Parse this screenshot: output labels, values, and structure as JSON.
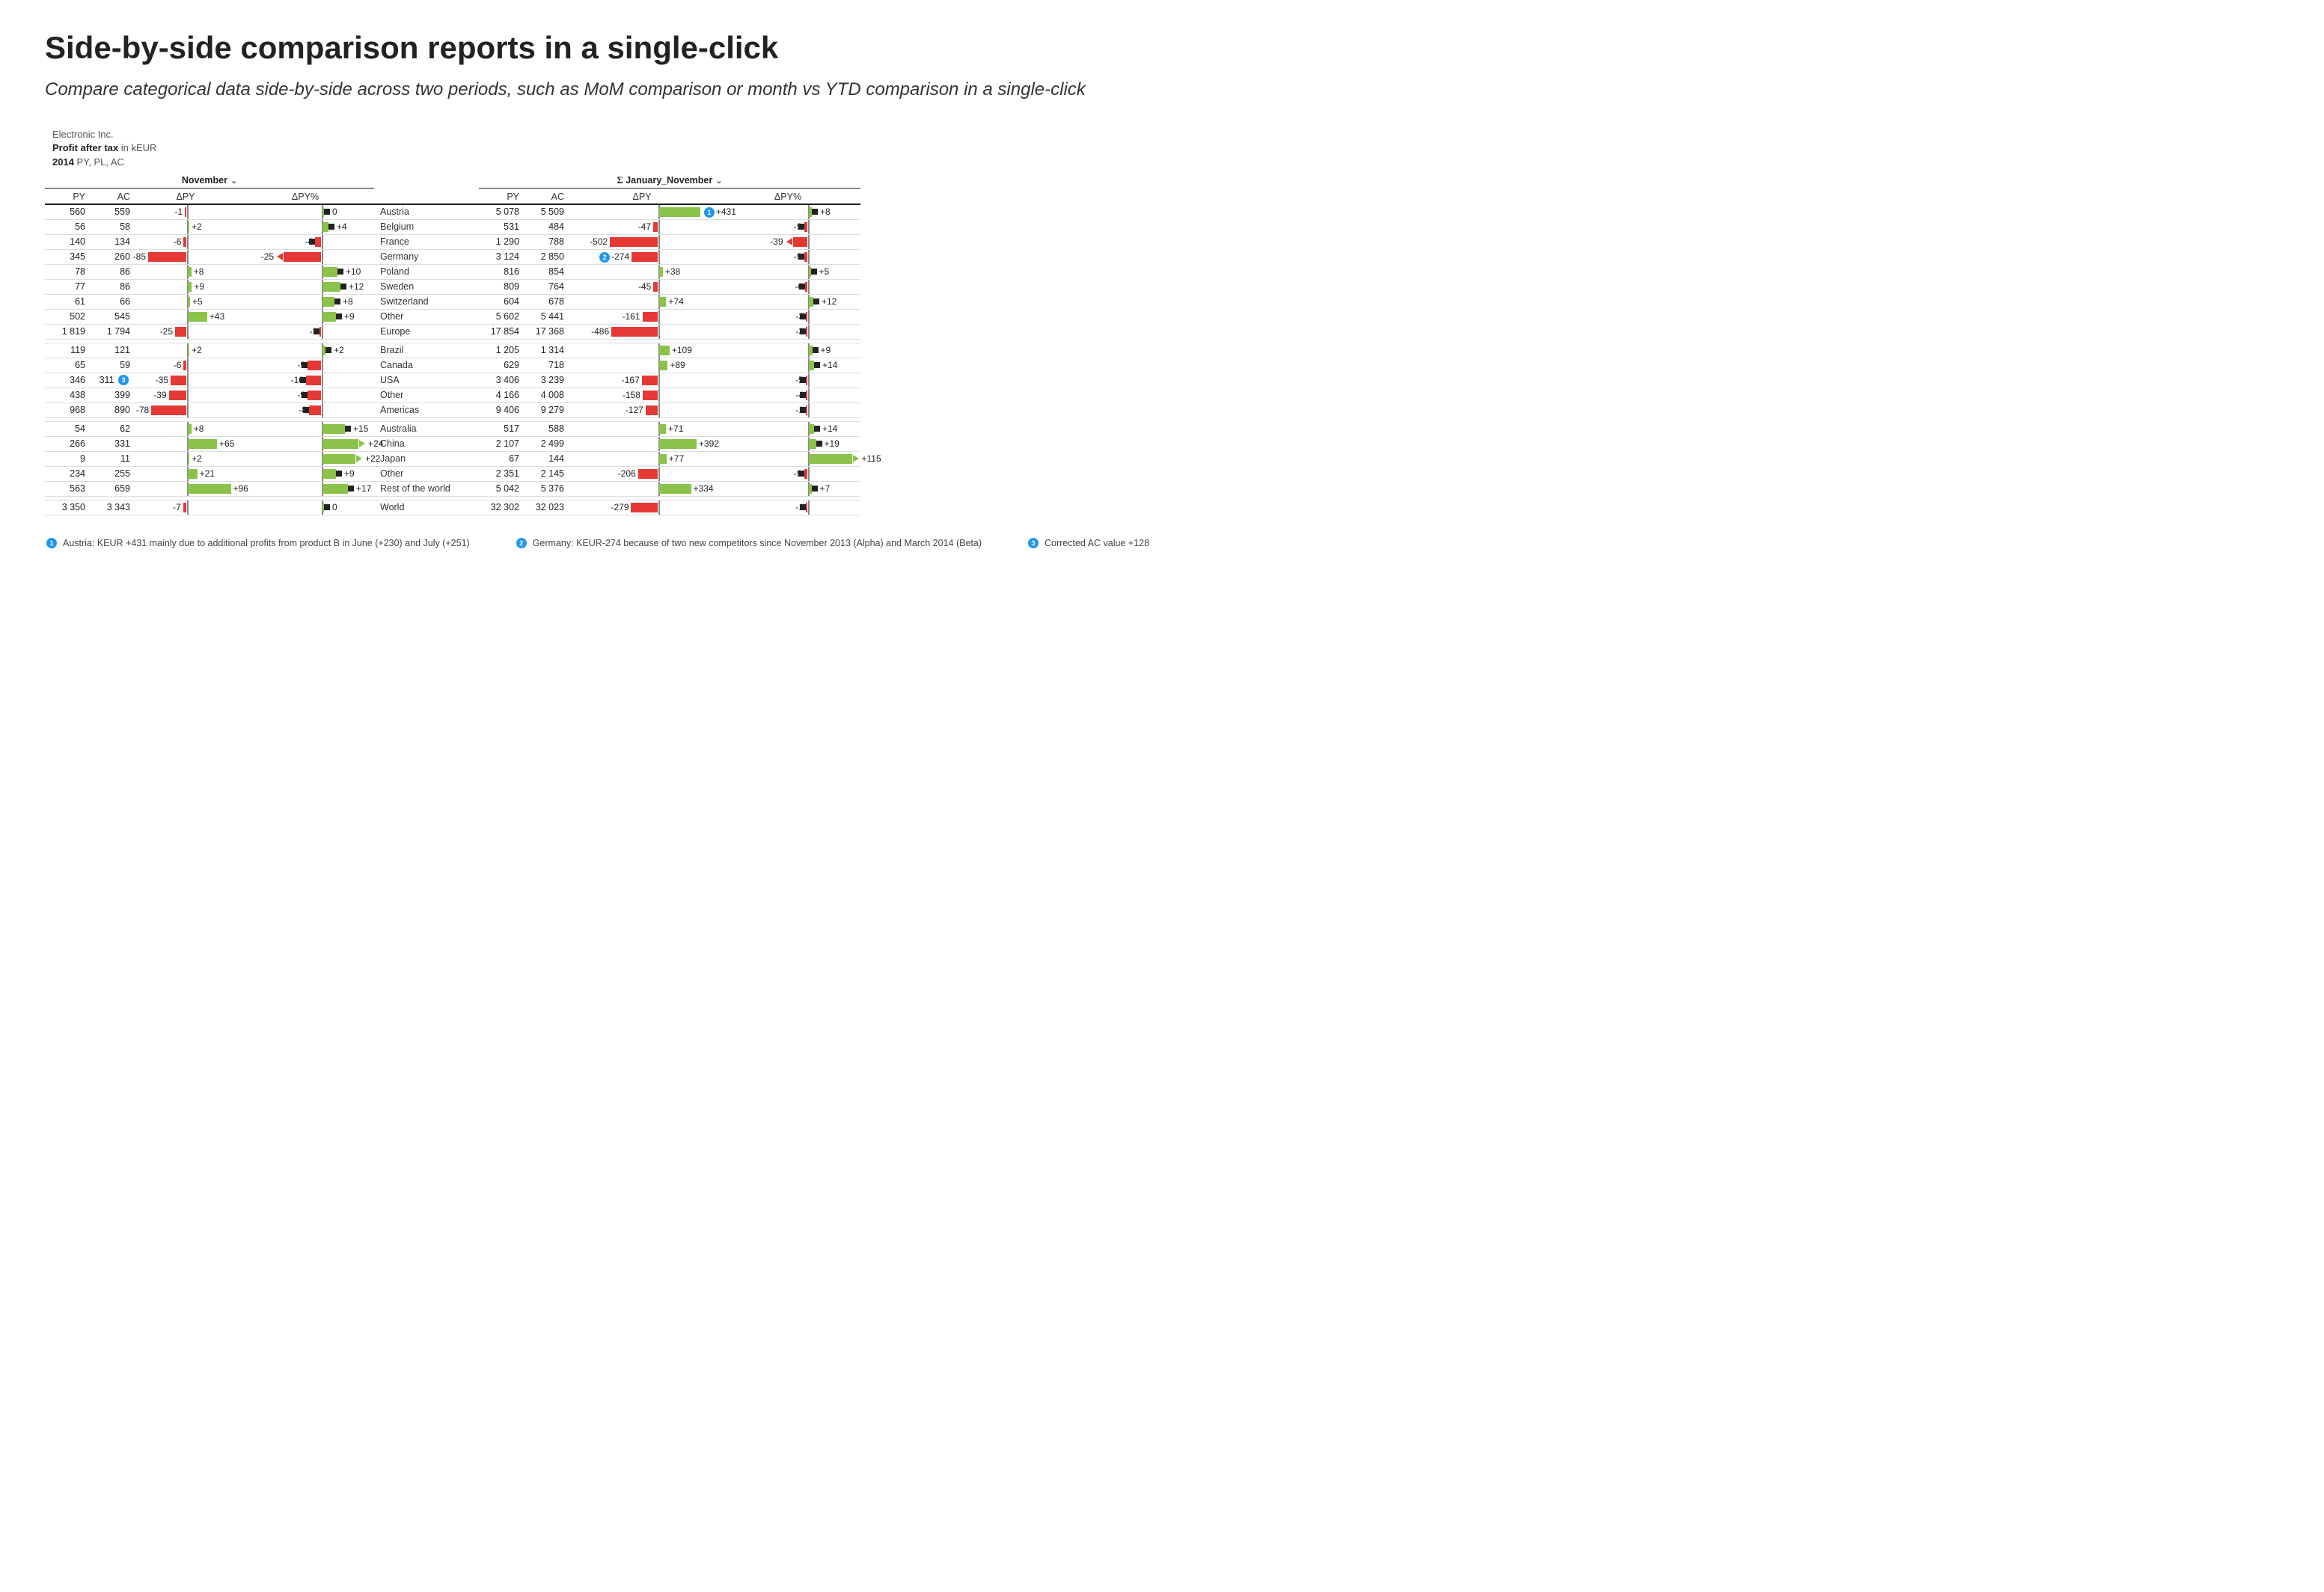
{
  "title": "Side-by-side comparison reports in a single-click",
  "subtitle": "Compare categorical data side-by-side across two periods, such as MoM comparison or month vs YTD comparison in a single-click",
  "header": {
    "company": "Electronic Inc.",
    "measure": "Profit after tax",
    "unit": "in kEUR",
    "year": "2014",
    "scenarios": "PY, PL, AC"
  },
  "period_left": "November",
  "period_right_prefix": "Σ",
  "period_right": "January_November",
  "columns": {
    "py": "PY",
    "ac": "AC",
    "dpy": "ΔPY",
    "dpypct": "ΔPY%"
  },
  "colors": {
    "pos": "#8bc34a",
    "neg": "#e53935",
    "axis": "#888",
    "marker": "#222",
    "badge": "#2196f3"
  },
  "chart_data": {
    "type": "table",
    "columns_left": [
      "PY",
      "AC",
      "ΔPY",
      "ΔPY%"
    ],
    "columns_right": [
      "PY",
      "AC",
      "ΔPY",
      "ΔPY%"
    ],
    "bar_scales": {
      "left_dpy_max_abs": 100,
      "left_dpypct_max_abs": 30,
      "right_dpy_max_abs": 550,
      "right_dpypct_max_abs": 120
    },
    "groups": [
      {
        "name": "Europe",
        "rows": [
          {
            "region": "Austria",
            "left": {
              "py": 560,
              "ac": 559,
              "dpy": -1,
              "dpypct": 0
            },
            "right": {
              "py": 5078,
              "ac": 5509,
              "dpy": 431,
              "dpypct": 8,
              "badge": 1
            }
          },
          {
            "region": "Belgium",
            "left": {
              "py": 56,
              "ac": 58,
              "dpy": 2,
              "dpypct": 4
            },
            "right": {
              "py": 531,
              "ac": 484,
              "dpy": -47,
              "dpypct": -9
            }
          },
          {
            "region": "France",
            "left": {
              "py": 140,
              "ac": 134,
              "dpy": -6,
              "dpypct": -4
            },
            "right": {
              "py": 1290,
              "ac": 788,
              "dpy": -502,
              "dpypct": -39,
              "arrow": "left"
            }
          },
          {
            "region": "Germany",
            "left": {
              "py": 345,
              "ac": 260,
              "dpy": -85,
              "dpypct": -25,
              "arrow": "left"
            },
            "right": {
              "py": 3124,
              "ac": 2850,
              "dpy": -274,
              "dpypct": -9,
              "badge": 2
            }
          },
          {
            "region": "Poland",
            "left": {
              "py": 78,
              "ac": 86,
              "dpy": 8,
              "dpypct": 10
            },
            "right": {
              "py": 816,
              "ac": 854,
              "dpy": 38,
              "dpypct": 5
            }
          },
          {
            "region": "Sweden",
            "left": {
              "py": 77,
              "ac": 86,
              "dpy": 9,
              "dpypct": 12
            },
            "right": {
              "py": 809,
              "ac": 764,
              "dpy": -45,
              "dpypct": -6
            }
          },
          {
            "region": "Switzerland",
            "left": {
              "py": 61,
              "ac": 66,
              "dpy": 5,
              "dpypct": 8
            },
            "right": {
              "py": 604,
              "ac": 678,
              "dpy": 74,
              "dpypct": 12
            }
          },
          {
            "region": "Other",
            "left": {
              "py": 502,
              "ac": 545,
              "dpy": 43,
              "dpypct": 9
            },
            "right": {
              "py": 5602,
              "ac": 5441,
              "dpy": -161,
              "dpypct": -3
            }
          }
        ],
        "total": {
          "left": {
            "py": 1819,
            "ac": 1794,
            "dpy": -25,
            "dpypct": -1
          },
          "right": {
            "py": 17854,
            "ac": 17368,
            "dpy": -486,
            "dpypct": -3
          }
        }
      },
      {
        "name": "Americas",
        "rows": [
          {
            "region": "Brazil",
            "left": {
              "py": 119,
              "ac": 121,
              "dpy": 2,
              "dpypct": 2
            },
            "right": {
              "py": 1205,
              "ac": 1314,
              "dpy": 109,
              "dpypct": 9
            }
          },
          {
            "region": "Canada",
            "left": {
              "py": 65,
              "ac": 59,
              "dpy": -6,
              "dpypct": -9
            },
            "right": {
              "py": 629,
              "ac": 718,
              "dpy": 89,
              "dpypct": 14
            }
          },
          {
            "region": "USA",
            "left": {
              "py": 346,
              "ac": 311,
              "dpy": -35,
              "dpypct": -10,
              "badge": 3
            },
            "right": {
              "py": 3406,
              "ac": 3239,
              "dpy": -167,
              "dpypct": -5
            }
          },
          {
            "region": "Other",
            "left": {
              "py": 438,
              "ac": 399,
              "dpy": -39,
              "dpypct": -9
            },
            "right": {
              "py": 4166,
              "ac": 4008,
              "dpy": -158,
              "dpypct": -4
            }
          }
        ],
        "total": {
          "left": {
            "py": 968,
            "ac": 890,
            "dpy": -78,
            "dpypct": -8
          },
          "right": {
            "py": 9406,
            "ac": 9279,
            "dpy": -127,
            "dpypct": -1
          }
        }
      },
      {
        "name": "Rest of the world",
        "rows": [
          {
            "region": "Australia",
            "left": {
              "py": 54,
              "ac": 62,
              "dpy": 8,
              "dpypct": 15
            },
            "right": {
              "py": 517,
              "ac": 588,
              "dpy": 71,
              "dpypct": 14
            }
          },
          {
            "region": "China",
            "left": {
              "py": 266,
              "ac": 331,
              "dpy": 65,
              "dpypct": 24,
              "arrow": "right"
            },
            "right": {
              "py": 2107,
              "ac": 2499,
              "dpy": 392,
              "dpypct": 19
            }
          },
          {
            "region": "Japan",
            "left": {
              "py": 9,
              "ac": 11,
              "dpy": 2,
              "dpypct": 22,
              "arrow": "right"
            },
            "right": {
              "py": 67,
              "ac": 144,
              "dpy": 77,
              "dpypct": 115,
              "arrow": "right"
            }
          },
          {
            "region": "Other",
            "left": {
              "py": 234,
              "ac": 255,
              "dpy": 21,
              "dpypct": 9
            },
            "right": {
              "py": 2351,
              "ac": 2145,
              "dpy": -206,
              "dpypct": -9
            }
          }
        ],
        "total": {
          "left": {
            "py": 563,
            "ac": 659,
            "dpy": 96,
            "dpypct": 17
          },
          "right": {
            "py": 5042,
            "ac": 5376,
            "dpy": 334,
            "dpypct": 7
          }
        }
      }
    ],
    "world": {
      "region": "World",
      "left": {
        "py": 3350,
        "ac": 3343,
        "dpy": -7,
        "dpypct": 0
      },
      "right": {
        "py": 32302,
        "ac": 32023,
        "dpy": -279,
        "dpypct": -1
      }
    }
  },
  "footnotes": [
    {
      "n": 1,
      "text": "Austria: KEUR +431 mainly due to additional profits from product B in June (+230) and July (+251)"
    },
    {
      "n": 2,
      "text": "Germany: KEUR-274 because of two new competitors since November 2013 (Alpha) and March 2014 (Beta)"
    },
    {
      "n": 3,
      "text": "Corrected AC value +128"
    }
  ]
}
